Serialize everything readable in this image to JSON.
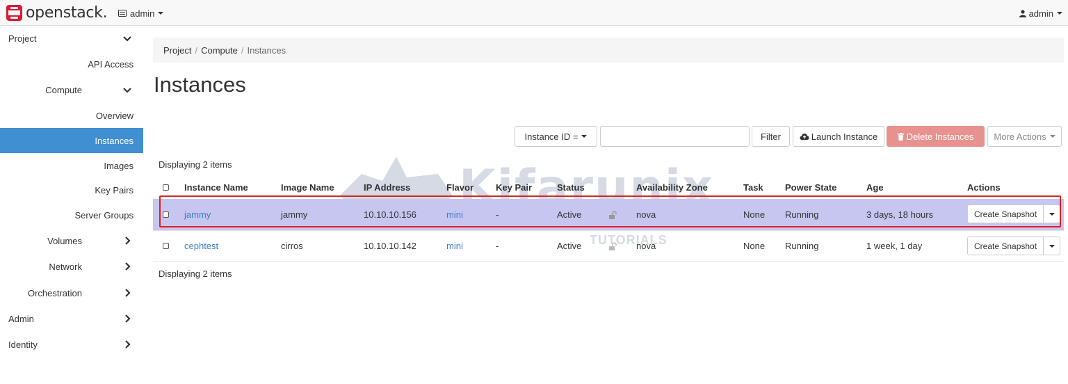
{
  "app": {
    "logo_text": "openstack.",
    "brand_color": "#da1a32"
  },
  "topbar": {
    "project_switcher": "admin",
    "user_menu": "admin"
  },
  "sidebar": {
    "items": [
      {
        "label": "Project",
        "level": 0,
        "chevron": "down"
      },
      {
        "label": "API Access",
        "level": 2
      },
      {
        "label": "Compute",
        "level": 1,
        "chevron": "down"
      },
      {
        "label": "Overview",
        "level": 2
      },
      {
        "label": "Instances",
        "level": 2,
        "active": true
      },
      {
        "label": "Images",
        "level": 2
      },
      {
        "label": "Key Pairs",
        "level": 2
      },
      {
        "label": "Server Groups",
        "level": 2
      },
      {
        "label": "Volumes",
        "level": 1,
        "chevron": "right"
      },
      {
        "label": "Network",
        "level": 1,
        "chevron": "right"
      },
      {
        "label": "Orchestration",
        "level": 1,
        "chevron": "right"
      },
      {
        "label": "Admin",
        "level": 0,
        "chevron": "right"
      },
      {
        "label": "Identity",
        "level": 0,
        "chevron": "right"
      }
    ],
    "active_color": "#3f8fd2"
  },
  "breadcrumb": {
    "items": [
      "Project",
      "Compute",
      "Instances"
    ]
  },
  "page": {
    "title": "Instances"
  },
  "toolbar": {
    "filter_select": "Instance ID =",
    "filter_value": "",
    "filter_button": "Filter",
    "launch_button": "Launch Instance",
    "delete_button": "Delete Instances",
    "more_actions": "More Actions"
  },
  "table": {
    "display_count": "Displaying 2 items",
    "columns": [
      "Instance Name",
      "Image Name",
      "IP Address",
      "Flavor",
      "Key Pair",
      "Status",
      "Availability Zone",
      "Task",
      "Power State",
      "Age",
      "Actions"
    ],
    "rows": [
      {
        "name": "jammy",
        "image": "jammy",
        "ip": "10.10.10.156",
        "flavor": "mini",
        "key_pair": "-",
        "status": "Active",
        "zone": "nova",
        "task": "None",
        "power": "Running",
        "age": "3 days, 18 hours",
        "action": "Create Snapshot",
        "selected": true
      },
      {
        "name": "cephtest",
        "image": "cirros",
        "ip": "10.10.10.142",
        "flavor": "mini",
        "key_pair": "-",
        "status": "Active",
        "zone": "nova",
        "task": "None",
        "power": "Running",
        "age": "1 week, 1 day",
        "action": "Create Snapshot",
        "selected": false
      }
    ],
    "highlight_color": "#e02020",
    "selected_row_color": "#c6c6f0"
  },
  "watermark": {
    "title": "Kifarunix",
    "subtitle": "*NIX TIPS & TUTORIALS"
  }
}
